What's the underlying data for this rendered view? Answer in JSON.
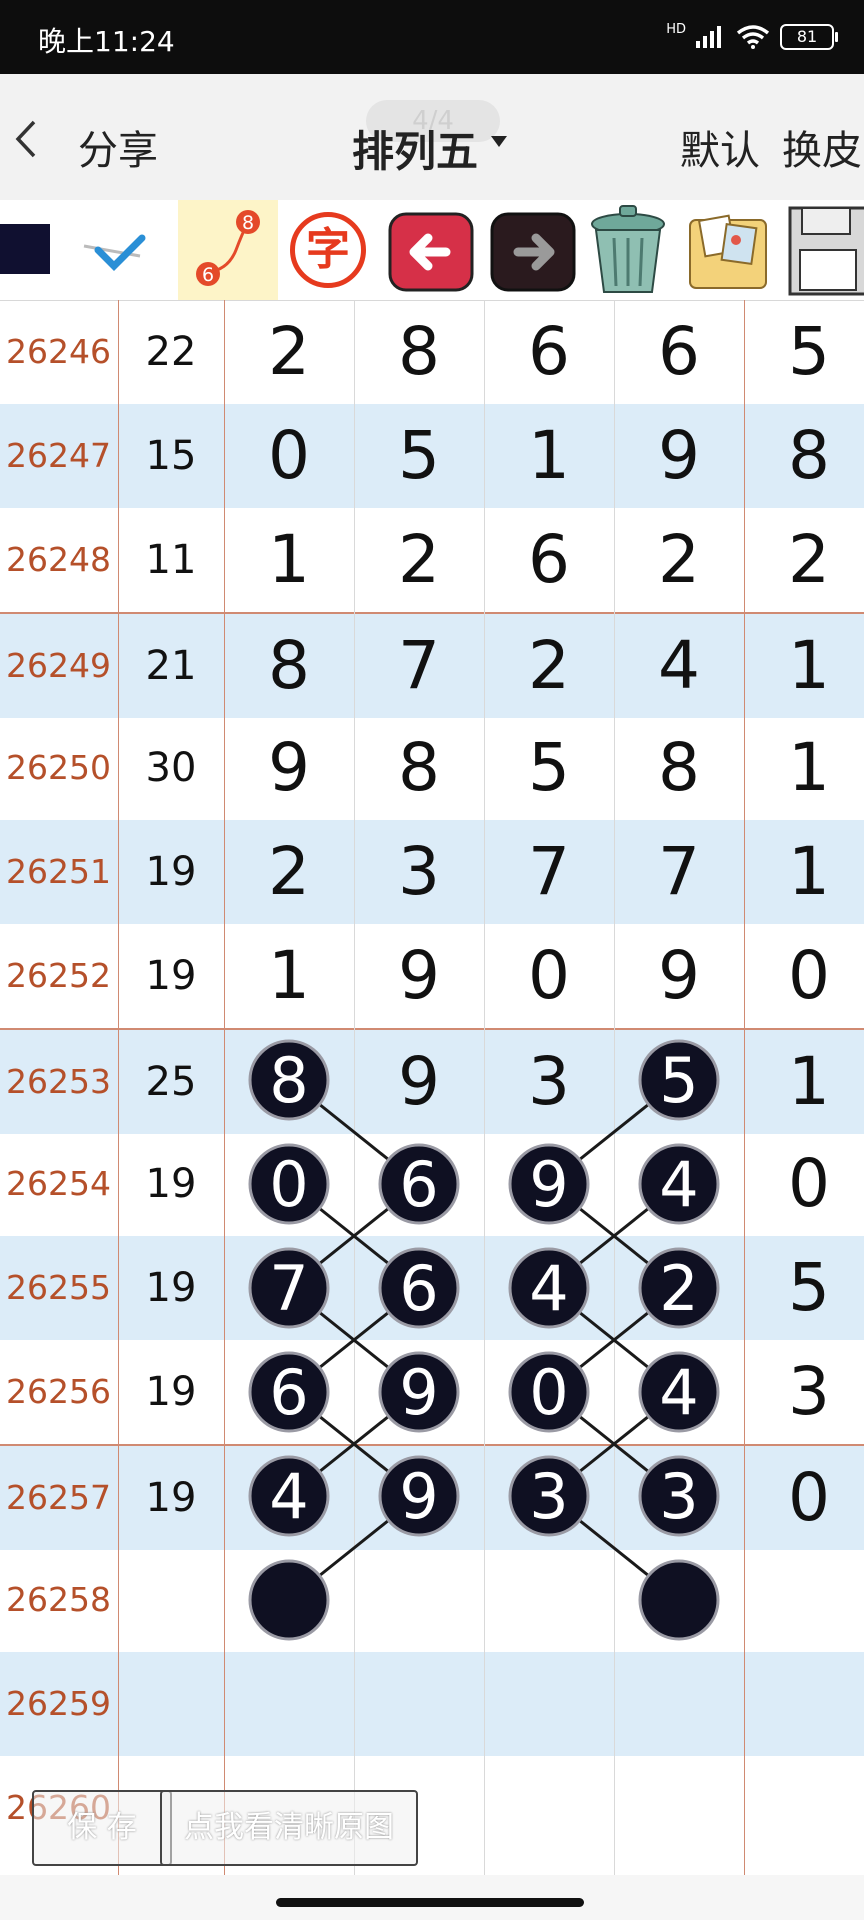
{
  "status_bar": {
    "time": "晚上11:24",
    "battery": "81",
    "network": "HD"
  },
  "nav": {
    "back_icon": "chevron-left-icon",
    "share_label": "分享",
    "title": "排列五",
    "page_indicator": "4/4",
    "default_label": "默认",
    "skin_label": "换皮"
  },
  "toolbar": {
    "tools": [
      "color-swatch-icon",
      "check-pen-icon",
      "connect-line-icon",
      "text-icon",
      "undo-arrow-icon",
      "redo-arrow-icon",
      "trash-icon",
      "photos-icon",
      "save-disk-icon"
    ],
    "connect_numbers": [
      "8",
      "6"
    ],
    "text_char": "字"
  },
  "table": {
    "rows": [
      {
        "period": "26246",
        "sum": "22",
        "digits": [
          "2",
          "8",
          "6",
          "6",
          "5"
        ]
      },
      {
        "period": "26247",
        "sum": "15",
        "digits": [
          "0",
          "5",
          "1",
          "9",
          "8"
        ]
      },
      {
        "period": "26248",
        "sum": "11",
        "digits": [
          "1",
          "2",
          "6",
          "2",
          "2"
        ]
      },
      {
        "period": "26249",
        "sum": "21",
        "digits": [
          "8",
          "7",
          "2",
          "4",
          "1"
        ]
      },
      {
        "period": "26250",
        "sum": "30",
        "digits": [
          "9",
          "8",
          "5",
          "8",
          "1"
        ]
      },
      {
        "period": "26251",
        "sum": "19",
        "digits": [
          "2",
          "3",
          "7",
          "7",
          "1"
        ]
      },
      {
        "period": "26252",
        "sum": "19",
        "digits": [
          "1",
          "9",
          "0",
          "9",
          "0"
        ]
      },
      {
        "period": "26253",
        "sum": "25",
        "digits": [
          "8",
          "9",
          "3",
          "5",
          "1"
        ]
      },
      {
        "period": "26254",
        "sum": "19",
        "digits": [
          "0",
          "6",
          "9",
          "4",
          "0"
        ]
      },
      {
        "period": "26255",
        "sum": "19",
        "digits": [
          "7",
          "6",
          "4",
          "2",
          "5"
        ]
      },
      {
        "period": "26256",
        "sum": "19",
        "digits": [
          "6",
          "9",
          "0",
          "4",
          "3"
        ]
      },
      {
        "period": "26257",
        "sum": "19",
        "digits": [
          "4",
          "9",
          "3",
          "3",
          "0"
        ]
      },
      {
        "period": "26258",
        "sum": "",
        "digits": [
          "",
          "",
          "",
          "",
          ""
        ]
      },
      {
        "period": "26259",
        "sum": "",
        "digits": [
          "",
          "",
          "",
          "",
          ""
        ]
      },
      {
        "period": "26260",
        "sum": "",
        "digits": [
          "",
          "",
          "",
          "",
          ""
        ]
      }
    ],
    "marked_balls": [
      {
        "row": 7,
        "col": 0
      },
      {
        "row": 8,
        "col": 0
      },
      {
        "row": 9,
        "col": 0
      },
      {
        "row": 10,
        "col": 0
      },
      {
        "row": 11,
        "col": 0
      },
      {
        "row": 12,
        "col": 0
      },
      {
        "row": 8,
        "col": 1
      },
      {
        "row": 9,
        "col": 1
      },
      {
        "row": 10,
        "col": 1
      },
      {
        "row": 11,
        "col": 1
      },
      {
        "row": 8,
        "col": 2
      },
      {
        "row": 9,
        "col": 2
      },
      {
        "row": 10,
        "col": 2
      },
      {
        "row": 11,
        "col": 2
      },
      {
        "row": 7,
        "col": 3
      },
      {
        "row": 8,
        "col": 3
      },
      {
        "row": 9,
        "col": 3
      },
      {
        "row": 10,
        "col": 3
      },
      {
        "row": 11,
        "col": 3
      },
      {
        "row": 12,
        "col": 3
      }
    ],
    "connector_lines": [
      [
        {
          "row": 7,
          "col": 0
        },
        {
          "row": 8,
          "col": 1
        }
      ],
      [
        {
          "row": 8,
          "col": 1
        },
        {
          "row": 9,
          "col": 0
        }
      ],
      [
        {
          "row": 9,
          "col": 0
        },
        {
          "row": 10,
          "col": 1
        }
      ],
      [
        {
          "row": 10,
          "col": 1
        },
        {
          "row": 11,
          "col": 0
        }
      ],
      [
        {
          "row": 8,
          "col": 0
        },
        {
          "row": 9,
          "col": 1
        }
      ],
      [
        {
          "row": 9,
          "col": 1
        },
        {
          "row": 10,
          "col": 0
        }
      ],
      [
        {
          "row": 10,
          "col": 0
        },
        {
          "row": 11,
          "col": 1
        }
      ],
      [
        {
          "row": 11,
          "col": 1
        },
        {
          "row": 12,
          "col": 0
        }
      ],
      [
        {
          "row": 7,
          "col": 3
        },
        {
          "row": 8,
          "col": 2
        }
      ],
      [
        {
          "row": 8,
          "col": 2
        },
        {
          "row": 9,
          "col": 3
        }
      ],
      [
        {
          "row": 9,
          "col": 3
        },
        {
          "row": 10,
          "col": 2
        }
      ],
      [
        {
          "row": 10,
          "col": 2
        },
        {
          "row": 11,
          "col": 3
        }
      ],
      [
        {
          "row": 8,
          "col": 3
        },
        {
          "row": 9,
          "col": 2
        }
      ],
      [
        {
          "row": 9,
          "col": 2
        },
        {
          "row": 10,
          "col": 3
        }
      ],
      [
        {
          "row": 10,
          "col": 3
        },
        {
          "row": 11,
          "col": 2
        }
      ],
      [
        {
          "row": 11,
          "col": 2
        },
        {
          "row": 12,
          "col": 3
        }
      ]
    ]
  },
  "buttons": {
    "save_label": "保 存",
    "view_original_label": "点我看清晰原图"
  },
  "colors": {
    "period_text": "#b5502a",
    "row_shade": "#dcecf8",
    "group_line": "#d08a72",
    "ball": "#0f1022"
  }
}
